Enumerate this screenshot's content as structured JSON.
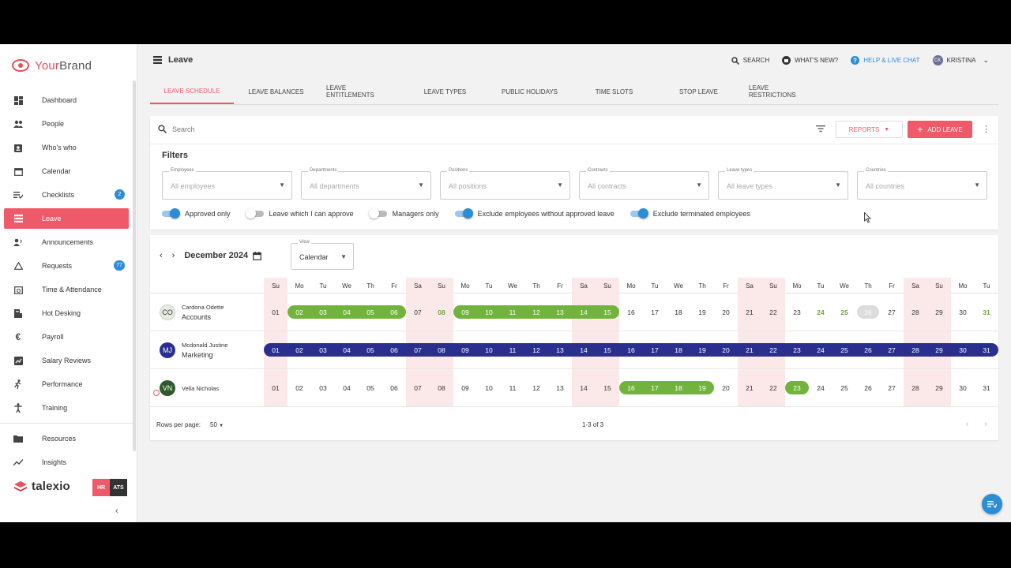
{
  "brand": {
    "name_a": "Your",
    "name_b": "Brand"
  },
  "header": {
    "title": "Leave",
    "search": "SEARCH",
    "whats_new": "WHAT'S NEW?",
    "help": "HELP & LIVE CHAT",
    "user_initials": "CK",
    "user_name": "KRISTINA"
  },
  "sidebar": {
    "items": [
      {
        "label": "Dashboard",
        "icon": "dashboard-icon"
      },
      {
        "label": "People",
        "icon": "people-icon"
      },
      {
        "label": "Who's who",
        "icon": "badge-icon"
      },
      {
        "label": "Calendar",
        "icon": "calendar-icon"
      },
      {
        "label": "Checklists",
        "icon": "checklist-icon",
        "badge": "2"
      },
      {
        "label": "Leave",
        "icon": "leave-icon",
        "active": true
      },
      {
        "label": "Announcements",
        "icon": "announcement-icon"
      },
      {
        "label": "Requests",
        "icon": "warning-icon",
        "badge": "77"
      },
      {
        "label": "Time & Attendance",
        "icon": "clock-icon"
      },
      {
        "label": "Hot Desking",
        "icon": "desk-icon"
      },
      {
        "label": "Payroll",
        "icon": "euro-icon"
      },
      {
        "label": "Salary Reviews",
        "icon": "chart-icon"
      },
      {
        "label": "Performance",
        "icon": "run-icon"
      },
      {
        "label": "Training",
        "icon": "person-icon"
      },
      {
        "label": "Resources",
        "icon": "folder-icon"
      },
      {
        "label": "Insights",
        "icon": "trend-icon"
      }
    ],
    "product": "talexio",
    "hr": "HR",
    "ats": "ATS"
  },
  "tabs": [
    "LEAVE SCHEDULE",
    "LEAVE BALANCES",
    "LEAVE ENTITLEMENTS",
    "LEAVE TYPES",
    "PUBLIC HOLIDAYS",
    "TIME SLOTS",
    "STOP LEAVE",
    "LEAVE RESTRICTIONS"
  ],
  "toolbar": {
    "search_placeholder": "Search",
    "reports": "REPORTS",
    "add_leave": "ADD LEAVE"
  },
  "filters": {
    "title": "Filters",
    "selects": [
      {
        "label": "Employees",
        "value": "All employees"
      },
      {
        "label": "Departments",
        "value": "All departments"
      },
      {
        "label": "Positions",
        "value": "All positions"
      },
      {
        "label": "Contracts",
        "value": "All contracts"
      },
      {
        "label": "Leave types",
        "value": "All leave types"
      },
      {
        "label": "Countries",
        "value": "All countries"
      }
    ],
    "toggles": [
      {
        "label": "Approved only",
        "on": true
      },
      {
        "label": "Leave which I can approve",
        "on": false
      },
      {
        "label": "Managers only",
        "on": false
      },
      {
        "label": "Exclude employees without approved leave",
        "on": true
      },
      {
        "label": "Exclude terminated employees",
        "on": true
      }
    ]
  },
  "calendar": {
    "month": "December 2024",
    "view_label": "View",
    "view_value": "Calendar",
    "weekdays": [
      "Su",
      "Mo",
      "Tu",
      "We",
      "Th",
      "Fr",
      "Sa",
      "Su",
      "Mo",
      "Tu",
      "We",
      "Th",
      "Fr",
      "Sa",
      "Su",
      "Mo",
      "Tu",
      "We",
      "Th",
      "Fr",
      "Sa",
      "Su",
      "Mo",
      "Tu",
      "We",
      "Th",
      "Fr",
      "Sa",
      "Su",
      "Mo",
      "Tu"
    ],
    "days": [
      "01",
      "02",
      "03",
      "04",
      "05",
      "06",
      "07",
      "08",
      "09",
      "10",
      "11",
      "12",
      "13",
      "14",
      "15",
      "16",
      "17",
      "18",
      "19",
      "20",
      "21",
      "22",
      "23",
      "24",
      "25",
      "26",
      "27",
      "28",
      "29",
      "30",
      "31"
    ],
    "colors": {
      "green": "#72b33e",
      "navy": "#2a2f8f",
      "weekend": "#fbe9ea",
      "accent": "#ef5a6a"
    },
    "rows": [
      {
        "initials": "CO",
        "name": "Cardona Odette",
        "dept": "Accounts",
        "avatar_bg": "#e8ebe0",
        "avatar_fg": "#333",
        "bars": [
          {
            "from": 2,
            "to": 6,
            "color": "green"
          },
          {
            "from": 9,
            "to": 15,
            "color": "green"
          }
        ],
        "green_text": [
          8,
          24,
          25,
          31
        ],
        "grey_pill": [
          26
        ]
      },
      {
        "initials": "MJ",
        "name": "Mcdonald Justine",
        "dept": "Marketing",
        "avatar_bg": "#2a2f8f",
        "avatar_fg": "#fff",
        "bars": [
          {
            "from": 1,
            "to": 31,
            "color": "navy"
          }
        ],
        "green_text": [],
        "grey_pill": []
      },
      {
        "initials": "VN",
        "name": "Vella Nicholas",
        "dept": "",
        "avatar_bg": "#2e5a2b",
        "avatar_fg": "#fff",
        "bars": [
          {
            "from": 16,
            "to": 19,
            "color": "green"
          },
          {
            "from": 23,
            "to": 23,
            "color": "green"
          }
        ],
        "green_text": [],
        "grey_pill": []
      }
    ]
  },
  "footer": {
    "rows_per_page_label": "Rows per page:",
    "rows_per_page": "50",
    "range": "1-3 of 3"
  }
}
